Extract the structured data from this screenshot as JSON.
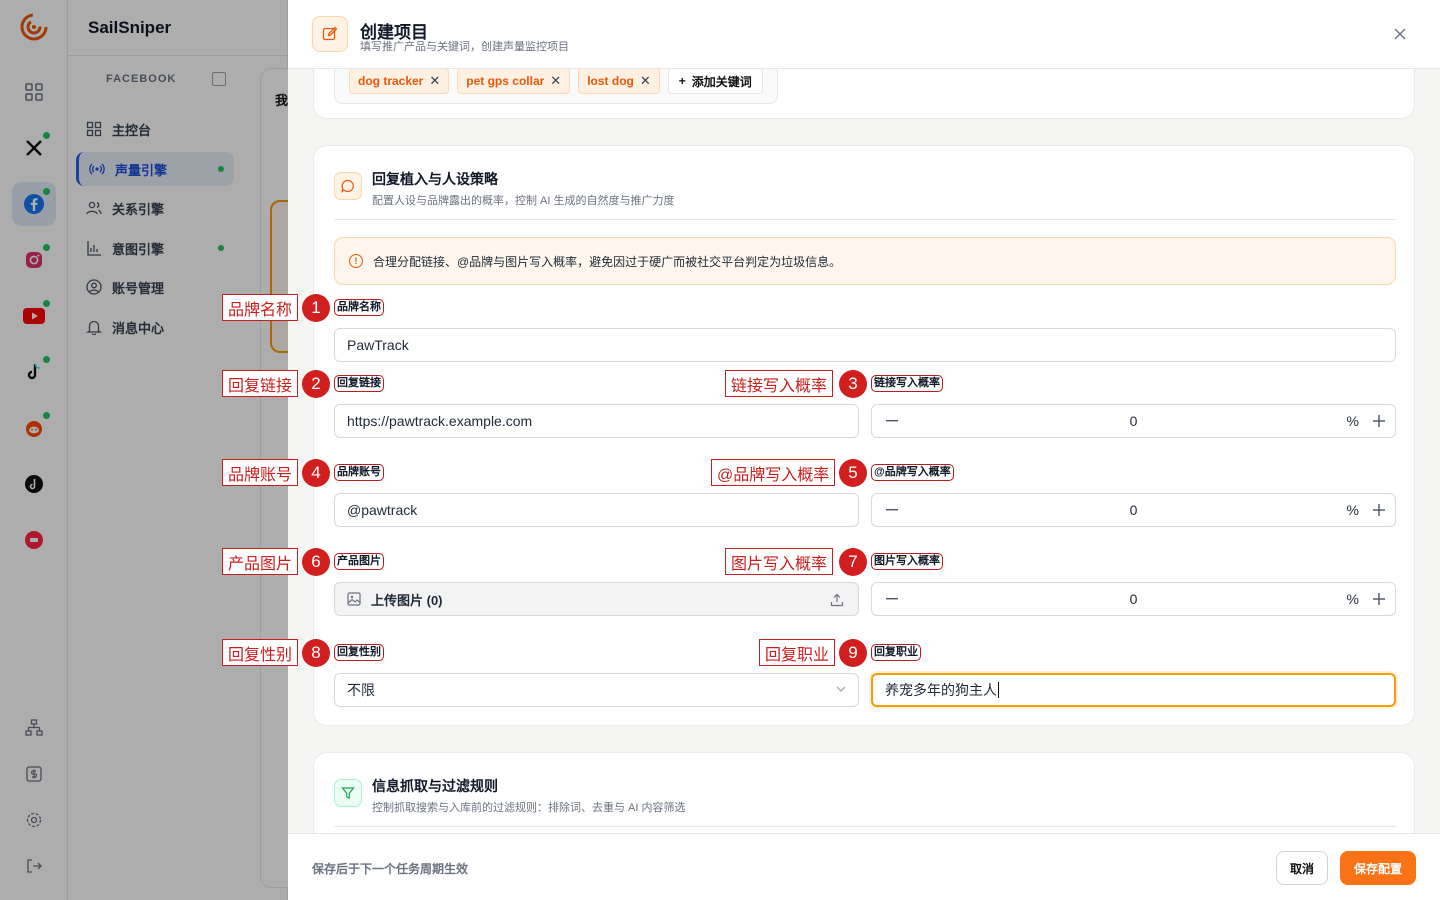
{
  "app": {
    "brand": "SailSniper"
  },
  "sidebar": {
    "section": "FACEBOOK",
    "items": [
      {
        "label": "主控台",
        "icon": "dashboard-icon"
      },
      {
        "label": "声量引擎",
        "icon": "broadcast-icon"
      },
      {
        "label": "关系引擎",
        "icon": "users-icon"
      },
      {
        "label": "意图引擎",
        "icon": "bar-chart-icon"
      },
      {
        "label": "账号管理",
        "icon": "account-icon"
      },
      {
        "label": "消息中心",
        "icon": "bell-icon"
      }
    ]
  },
  "background": {
    "title_fragment": "我"
  },
  "drawer": {
    "title": "创建项目",
    "subtitle": "填写推广产品与关键词，创建声量监控项目",
    "keywords": [
      "dog tracker",
      "pet gps collar",
      "lost dog"
    ],
    "add_keyword": "添加关键词",
    "section_reply": {
      "title": "回复植入与人设策略",
      "subtitle": "配置人设与品牌露出的概率，控制 AI 生成的自然度与推广力度",
      "notice": "合理分配链接、@品牌与图片写入概率，避免因过于硬广而被社交平台判定为垃圾信息。"
    },
    "fields": {
      "brand_name": {
        "label": "品牌名称",
        "value": "PawTrack"
      },
      "reply_link": {
        "label": "回复链接",
        "value": "https://pawtrack.example.com"
      },
      "link_prob": {
        "label": "链接写入概率",
        "value": "0",
        "unit": "%"
      },
      "brand_account": {
        "label": "品牌账号",
        "value": "@pawtrack"
      },
      "brand_prob": {
        "label": "@品牌写入概率",
        "value": "0",
        "unit": "%"
      },
      "product_image": {
        "label": "产品图片",
        "upload_label": "上传图片 (0)"
      },
      "image_prob": {
        "label": "图片写入概率",
        "value": "0",
        "unit": "%"
      },
      "reply_gender": {
        "label": "回复性别",
        "value": "不限"
      },
      "reply_job": {
        "label": "回复职业",
        "value": "养宠多年的狗主人"
      }
    },
    "section_filter": {
      "title": "信息抓取与过滤规则",
      "subtitle": "控制抓取搜索与入库前的过滤规则：排除词、去重与 AI 内容筛选"
    },
    "footer": {
      "note": "保存后于下一个任务周期生效",
      "cancel": "取消",
      "save": "保存配置"
    }
  },
  "annotations": [
    {
      "num": "1",
      "text": "品牌名称"
    },
    {
      "num": "2",
      "text": "回复链接"
    },
    {
      "num": "3",
      "text": "链接写入概率"
    },
    {
      "num": "4",
      "text": "品牌账号"
    },
    {
      "num": "5",
      "text": "@品牌写入概率"
    },
    {
      "num": "6",
      "text": "产品图片"
    },
    {
      "num": "7",
      "text": "图片写入概率"
    },
    {
      "num": "8",
      "text": "回复性别"
    },
    {
      "num": "9",
      "text": "回复职业"
    }
  ],
  "colors": {
    "accent": "#f97316",
    "focus": "#f59e0b",
    "annotation": "#d11f1f",
    "nav_active": "#1d4ed8"
  }
}
